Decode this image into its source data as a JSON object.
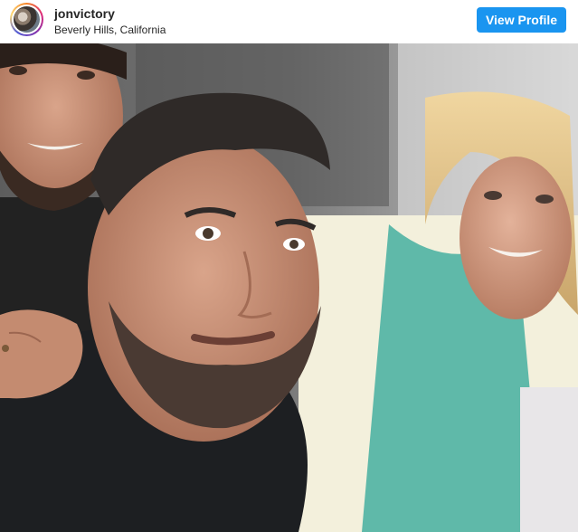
{
  "header": {
    "username": "jonvictory",
    "location": "Beverly Hills, California",
    "view_profile_label": "View Profile"
  },
  "colors": {
    "button_bg": "#1a95f0",
    "text_primary": "#262626"
  },
  "icons": {
    "avatar": "profile-avatar-ring"
  }
}
